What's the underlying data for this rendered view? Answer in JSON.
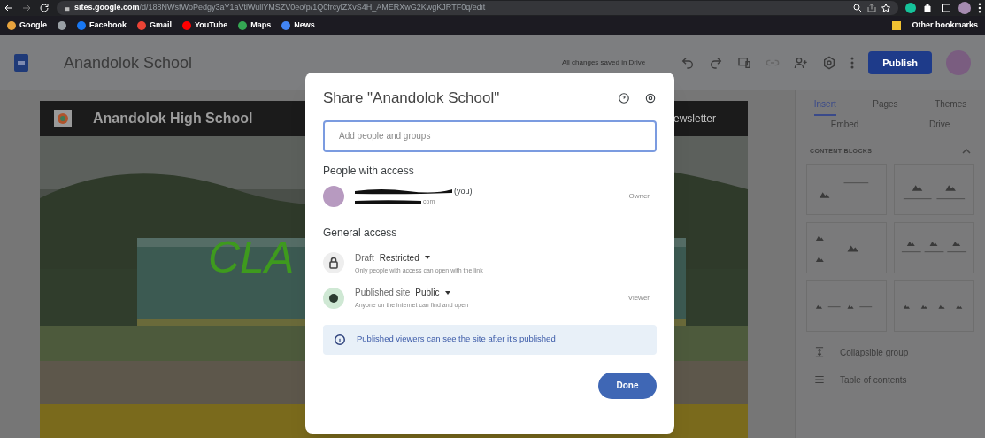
{
  "browser": {
    "url_host": "sites.google.com",
    "url_path": "/d/188NWsfWoPedgy3aY1aVtlWullYMSZV0eo/p/1Q0frcylZXvS4H_AMERXwG2KwgKJRTF0q/edit",
    "bookmarks": [
      {
        "label": "Google",
        "color": "#e8a33d"
      },
      {
        "color": "#9aa0a6"
      },
      {
        "label": "Facebook",
        "color": "#1877f2"
      },
      {
        "label": "Gmail",
        "color": "#ea4335"
      },
      {
        "label": "YouTube",
        "color": "#ff0000"
      },
      {
        "label": "Maps",
        "color": "#34a853"
      },
      {
        "label": "News",
        "color": "#4285f4"
      }
    ],
    "other_bookmarks": "Other bookmarks"
  },
  "app_bar": {
    "title": "Anandolok School",
    "save_status": "All changes saved in Drive",
    "publish": "Publish"
  },
  "site": {
    "name": "Anandolok High School",
    "nav_item": "ewsletter",
    "hero_title": "CLA"
  },
  "panel": {
    "tabs": [
      {
        "label": "Insert",
        "selected": true
      },
      {
        "label": "Pages",
        "selected": false
      },
      {
        "label": "Themes",
        "selected": false
      }
    ],
    "quick_items": [
      "Embed",
      "Drive"
    ],
    "section": "CONTENT BLOCKS",
    "expanded": true,
    "blocks": [
      {
        "kind": "image-text"
      },
      {
        "kind": "two-images"
      },
      {
        "kind": "three-images"
      },
      {
        "kind": "three-captions"
      },
      {
        "kind": "two-small"
      },
      {
        "kind": "four-captions"
      }
    ],
    "items": [
      {
        "label": "Collapsible group"
      },
      {
        "label": "Table of contents"
      }
    ]
  },
  "dialog": {
    "title": "Share \"Anandolok School\"",
    "placeholder": "Add people and groups",
    "people_heading": "People with access",
    "person": {
      "suffix": "(you)",
      "email_end": "com",
      "role": "Owner",
      "disabled": true
    },
    "general_heading": "General access",
    "access": [
      {
        "kind": "lock",
        "label": "Draft",
        "value": "Restricted",
        "description": "Only people with access can open with the link"
      },
      {
        "kind": "globe",
        "label": "Published site",
        "value": "Public",
        "description": "Anyone on the internet can find and open",
        "role": "Viewer"
      }
    ],
    "notice": "Published viewers can see the site after it's published",
    "done": "Done"
  }
}
